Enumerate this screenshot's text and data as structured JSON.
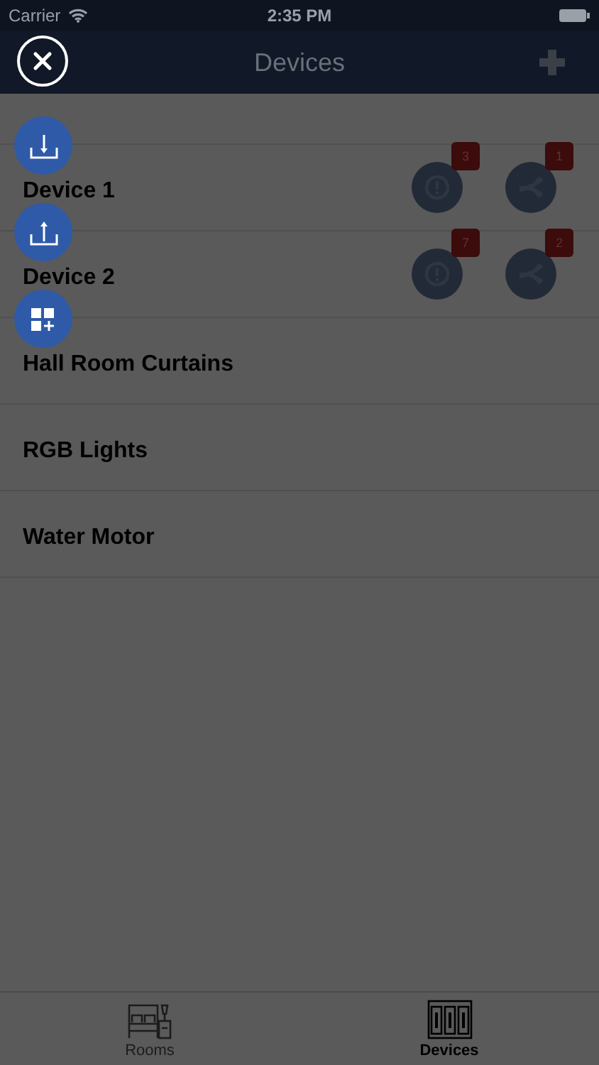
{
  "status_bar": {
    "carrier": "Carrier",
    "time": "2:35 PM"
  },
  "nav": {
    "title": "Devices"
  },
  "devices": [
    {
      "name": "Device 1",
      "indicators": [
        {
          "kind": "alert",
          "count": "3"
        },
        {
          "kind": "fan",
          "count": "1"
        }
      ]
    },
    {
      "name": "Device 2",
      "indicators": [
        {
          "kind": "alert",
          "count": "7"
        },
        {
          "kind": "fan",
          "count": "2"
        }
      ]
    },
    {
      "name": "Hall Room Curtains"
    },
    {
      "name": "RGB Lights"
    },
    {
      "name": "Water Motor"
    }
  ],
  "fab_actions": [
    {
      "kind": "import"
    },
    {
      "kind": "export"
    },
    {
      "kind": "add-widget"
    }
  ],
  "tabs": [
    {
      "label": "Rooms",
      "kind": "rooms",
      "selected": false
    },
    {
      "label": "Devices",
      "kind": "devices",
      "selected": true
    }
  ]
}
